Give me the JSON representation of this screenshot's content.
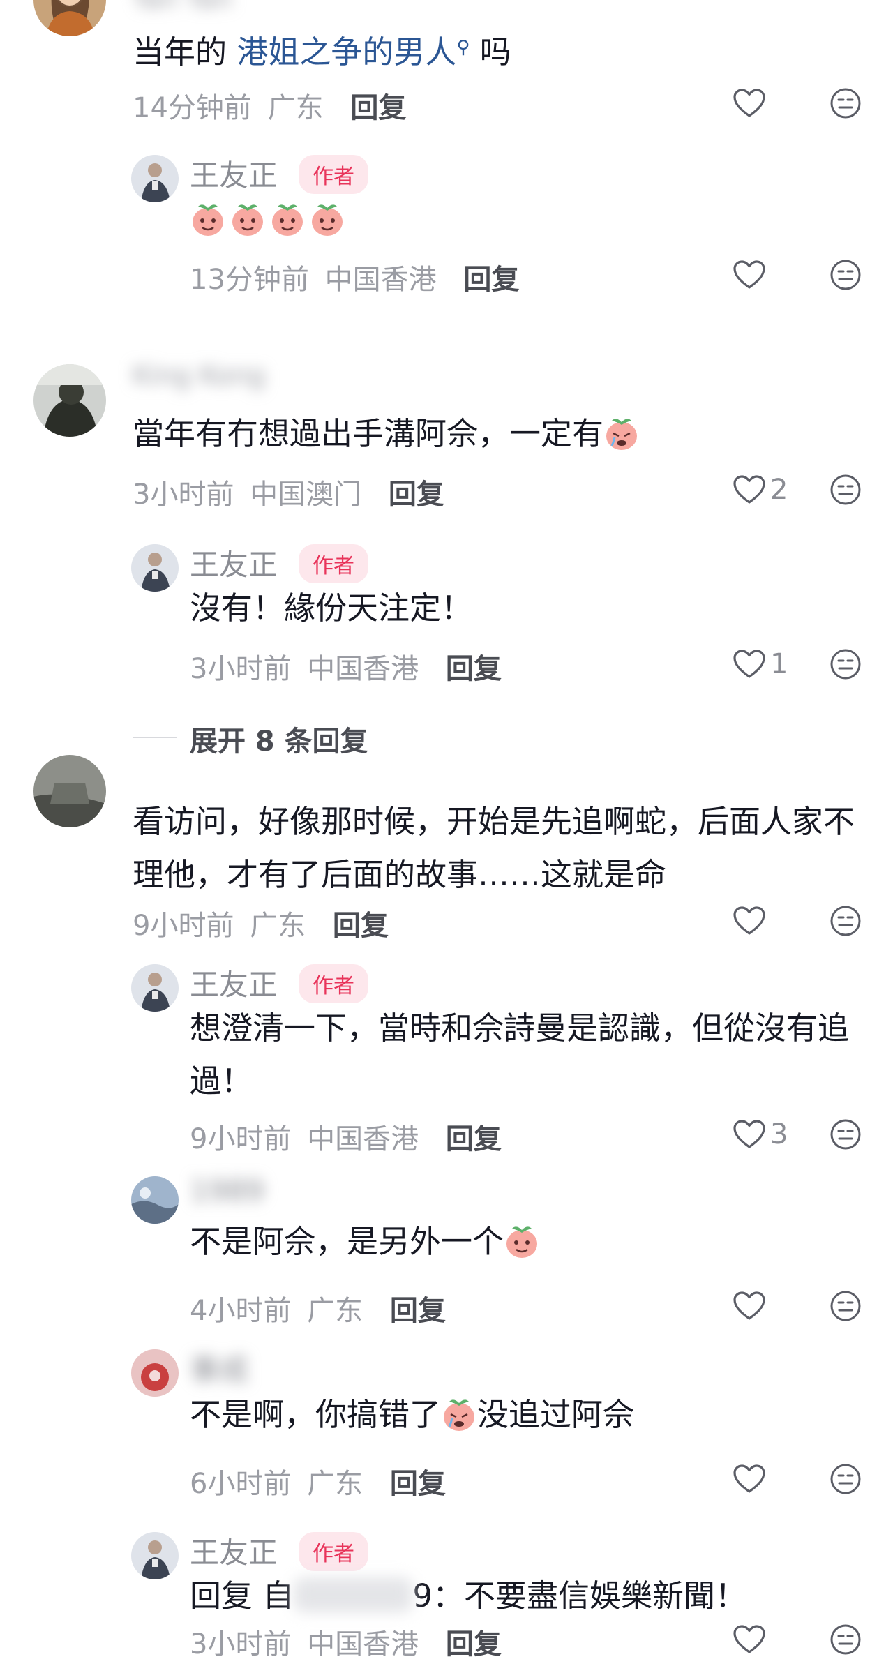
{
  "comments": [
    {
      "name": "Yan Yan",
      "content_prefix": "当年的",
      "content_link": "港姐之争的男人",
      "content_suffix": "吗",
      "time": "14分钟前",
      "location": "广东",
      "reply_label": "回复",
      "like_count": ""
    },
    {
      "name": "王友正",
      "badge": "作者",
      "content": "",
      "time": "13分钟前",
      "location": "中国香港",
      "reply_label": "回复",
      "like_count": ""
    },
    {
      "name": "King Kong",
      "content": "當年有冇想過出手溝阿佘，一定有",
      "time": "3小时前",
      "location": "中国澳门",
      "reply_label": "回复",
      "like_count": "2"
    },
    {
      "name": "王友正",
      "badge": "作者",
      "content": "沒有！緣份天注定！",
      "time": "3小时前",
      "location": "中国香港",
      "reply_label": "回复",
      "like_count": "1"
    },
    {
      "expand_label": "展开 8 条回复"
    },
    {
      "content": "看访问，好像那时候，开始是先追啊蛇，后面人家不理他，才有了后面的故事……这就是命",
      "time": "9小时前",
      "location": "广东",
      "reply_label": "回复",
      "like_count": ""
    },
    {
      "name": "王友正",
      "badge": "作者",
      "content": "想澄清一下，當時和佘詩曼是認識，但從沒有追過！",
      "time": "9小时前",
      "location": "中国香港",
      "reply_label": "回复",
      "like_count": "3"
    },
    {
      "name": "1989",
      "content": "不是阿佘，是另外一个",
      "time": "4小时前",
      "location": "广东",
      "reply_label": "回复",
      "like_count": ""
    },
    {
      "name": "事成",
      "content": "不是啊，你搞错了没追过阿佘",
      "content_emoji_split": [
        "不是啊，你搞错了",
        "没追过阿佘"
      ],
      "time": "6小时前",
      "location": "广东",
      "reply_label": "回复",
      "like_count": ""
    },
    {
      "name": "王友正",
      "badge": "作者",
      "content_prefix": "回复 自",
      "content_suffix": "9：不要盡信娛樂新聞！",
      "time": "3小时前",
      "location": "中国香港",
      "reply_label": "回复",
      "like_count": ""
    }
  ],
  "icons": {
    "like": "heart-outline-icon",
    "dislike": "neutral-face-icon",
    "search_link": "search-icon",
    "emoji": "peach-emoji-icon"
  },
  "colors": {
    "author_badge_text": "#e8345a",
    "author_badge_bg": "#fde7ec",
    "link": "#2b5694",
    "meta": "#9a9ca3"
  }
}
